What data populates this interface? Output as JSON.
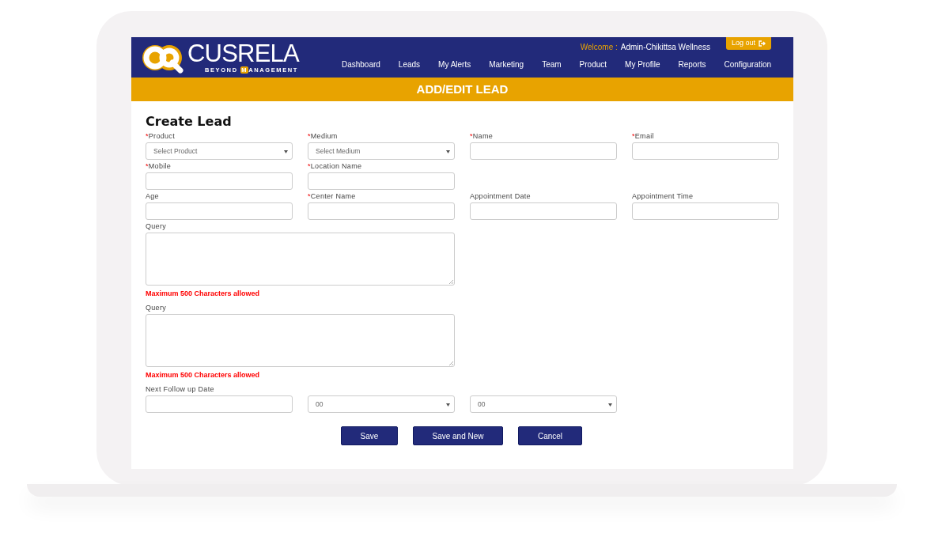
{
  "header": {
    "logo": {
      "wordmark": "**CUS**RELA",
      "tagline_start": "BEYOND ",
      "tagline_mark": "M",
      "tagline_end": "ANAGEMENT"
    },
    "welcome_label": "Welcome :",
    "user_name": "Admin-Chikittsa Wellness",
    "logout_button": "Log out",
    "nav": [
      "Dashboard",
      "Leads",
      "My Alerts",
      "Marketing",
      "Team",
      "Product",
      "My Profile",
      "Reports",
      "Configuration"
    ]
  },
  "banner": "ADD/EDIT LEAD",
  "form": {
    "title": "Create Lead",
    "rows": [
      [
        {
          "kind": "select",
          "mark": "*",
          "label": "Product",
          "value": "Select Product"
        },
        {
          "kind": "select",
          "mark": "*",
          "label": "Medium",
          "value": "Select Medium"
        },
        {
          "kind": "input",
          "mark": "*",
          "label": "Name"
        },
        {
          "kind": "input",
          "mark": "*",
          "label": "Email"
        }
      ],
      [
        {
          "kind": "input",
          "mark": "*",
          "label": "Mobile"
        },
        {
          "kind": "input",
          "mark": "*",
          "label": "Location Name"
        }
      ],
      [
        {
          "kind": "input",
          "label": "Age"
        },
        {
          "kind": "input",
          "mark": "*",
          "label": "Center Name"
        },
        {
          "kind": "input",
          "label": "Appointment Date"
        },
        {
          "kind": "input",
          "label": "Appointment Time"
        }
      ],
      [
        {
          "kind": "textarea",
          "label": "Query"
        }
      ],
      [
        {
          "kind": "note",
          "label": "Maximum 500 Characters allowed"
        }
      ],
      [
        {
          "kind": "textarea",
          "label": "Query"
        }
      ],
      [
        {
          "kind": "note",
          "label": "Maximum 500 Characters allowed"
        }
      ],
      [
        {
          "kind": "input",
          "label": "Next Follow up Date"
        },
        {
          "kind": "select",
          "value": "00"
        },
        {
          "kind": "select",
          "value": "00"
        }
      ]
    ],
    "buttons": [
      "Save",
      "Save and New",
      "Cancel"
    ]
  }
}
